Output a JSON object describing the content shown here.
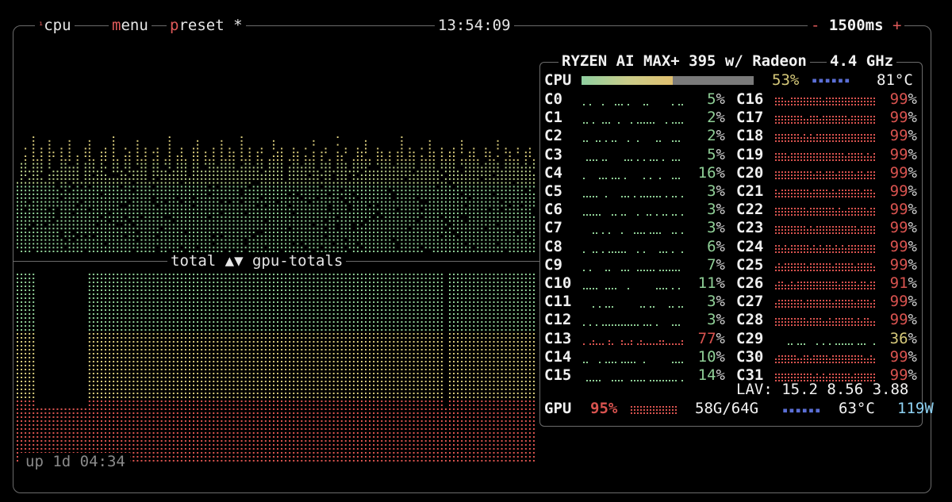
{
  "header": {
    "cpu_superscript": "¹",
    "cpu_label": "cpu",
    "menu_key": "m",
    "menu_rest": "enu",
    "preset_key": "p",
    "preset_rest": "reset *",
    "clock": "13:54:09",
    "minus": "-",
    "interval": "1500ms",
    "plus": "+"
  },
  "graph": {
    "middle_label": "total ▲▼ gpu-totals",
    "uptime": "up 1d 04:34",
    "top_bars": [
      0.6,
      0.8,
      0.9,
      0.7,
      1.0,
      0.8,
      0.9,
      0.6,
      0.95,
      0.85,
      0.7,
      0.9,
      0.8,
      1.0,
      0.75,
      0.85,
      0.6,
      0.9,
      0.95,
      0.8,
      0.7,
      0.85,
      0.9,
      0.65,
      1.0,
      0.8,
      0.75,
      0.9,
      0.85,
      0.7,
      0.95,
      0.8,
      0.9,
      0.6,
      0.85,
      0.9,
      0.75,
      0.8,
      1.0,
      0.7,
      0.85,
      0.9,
      0.8,
      0.65,
      0.9,
      0.95,
      0.7,
      0.85,
      0.8,
      0.9,
      0.75,
      0.95,
      0.8,
      0.9,
      0.85,
      0.7,
      1.0,
      0.8,
      0.9,
      0.75,
      0.85,
      0.9,
      0.7,
      0.8,
      0.95,
      0.85,
      0.9,
      0.6,
      0.8,
      0.9,
      0.85,
      0.75,
      0.9,
      0.8,
      0.95,
      0.7,
      0.85,
      0.9,
      0.8,
      0.75,
      1.0,
      0.85,
      0.9,
      0.7,
      0.8,
      0.9,
      0.85,
      0.95,
      0.8,
      0.7,
      0.9,
      0.85,
      0.8,
      0.9,
      0.75,
      0.85,
      1.0,
      0.8,
      0.9,
      0.85,
      0.7,
      0.9,
      0.8,
      0.95,
      0.85,
      0.75,
      0.9,
      0.8,
      0.85,
      0.9,
      0.7,
      0.95,
      0.8,
      0.85,
      0.9,
      0.8,
      0.75,
      0.9,
      0.85,
      0.8,
      0.95,
      0.7,
      0.9,
      0.85,
      0.8,
      0.9,
      0.75,
      0.85,
      0.9,
      0.8
    ],
    "bottom_dip_columns": [
      5,
      6,
      7,
      8,
      9,
      10,
      11,
      12,
      13,
      14,
      15,
      16,
      17,
      107
    ]
  },
  "cpu_panel": {
    "model": "RYZEN AI MAX+ 395 w/ Radeon",
    "freq": "4.4 GHz",
    "cpu_label": "CPU",
    "cpu_pct": "53",
    "cpu_value": 0.53,
    "cpu_temp": "81°C",
    "cpu_temp_bar": "▪▪▪▪▪▪",
    "pct_unit": "%",
    "left_cores": [
      {
        "name": "C0",
        "pct": "5"
      },
      {
        "name": "C1",
        "pct": "2"
      },
      {
        "name": "C2",
        "pct": "2"
      },
      {
        "name": "C3",
        "pct": "5"
      },
      {
        "name": "C4",
        "pct": "16"
      },
      {
        "name": "C5",
        "pct": "3"
      },
      {
        "name": "C6",
        "pct": "3"
      },
      {
        "name": "C7",
        "pct": "3"
      },
      {
        "name": "C8",
        "pct": "6"
      },
      {
        "name": "C9",
        "pct": "7"
      },
      {
        "name": "C10",
        "pct": "11"
      },
      {
        "name": "C11",
        "pct": "3"
      },
      {
        "name": "C12",
        "pct": "3"
      },
      {
        "name": "C13",
        "pct": "77"
      },
      {
        "name": "C14",
        "pct": "10"
      },
      {
        "name": "C15",
        "pct": "14"
      }
    ],
    "right_cores": [
      {
        "name": "C16",
        "pct": "99"
      },
      {
        "name": "C17",
        "pct": "99"
      },
      {
        "name": "C18",
        "pct": "99"
      },
      {
        "name": "C19",
        "pct": "99"
      },
      {
        "name": "C20",
        "pct": "99"
      },
      {
        "name": "C21",
        "pct": "99"
      },
      {
        "name": "C22",
        "pct": "99"
      },
      {
        "name": "C23",
        "pct": "99"
      },
      {
        "name": "C24",
        "pct": "99"
      },
      {
        "name": "C25",
        "pct": "99"
      },
      {
        "name": "C26",
        "pct": "91"
      },
      {
        "name": "C27",
        "pct": "99"
      },
      {
        "name": "C28",
        "pct": "99"
      },
      {
        "name": "C29",
        "pct": "36"
      },
      {
        "name": "C30",
        "pct": "99"
      },
      {
        "name": "C31",
        "pct": "99"
      }
    ],
    "lav_label": "LAV:",
    "lav_values": "15.2 8.56 3.88",
    "gpu_label": "GPU",
    "gpu_pct": "95",
    "gpu_mem": "58G/64G",
    "gpu_temp_bar": "▪▪▪▪▪▪",
    "gpu_temp": "63°C",
    "gpu_power": "119W"
  },
  "colors": {
    "low": "#8fcf96",
    "mid": "#d6c97a",
    "high": "#d9534f",
    "blue": "#5b6fd6",
    "power": "#8fd3f4"
  }
}
